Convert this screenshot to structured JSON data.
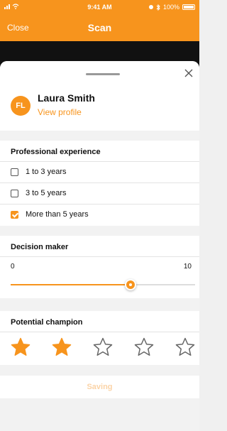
{
  "status_bar": {
    "time": "9:41 AM",
    "battery": "100%"
  },
  "nav": {
    "close_label": "Close",
    "title": "Scan"
  },
  "profile": {
    "initials": "FL",
    "name": "Laura Smith",
    "view_profile_label": "View profile"
  },
  "experience": {
    "title": "Professional experience",
    "options": [
      {
        "label": "1 to 3 years",
        "checked": false
      },
      {
        "label": "3 to 5 years",
        "checked": false
      },
      {
        "label": "More than 5 years",
        "checked": true
      }
    ]
  },
  "decision_maker": {
    "title": "Decision maker",
    "min_label": "0",
    "max_label": "10",
    "value": 6.5,
    "min": 0,
    "max": 10
  },
  "champion": {
    "title": "Potential champion",
    "rating": 2,
    "max_rating": 5
  },
  "save": {
    "label": "Saving"
  },
  "colors": {
    "accent": "#f7941d",
    "accent_faded": "#fbd3a6",
    "background": "#f2f2f2"
  },
  "icons": [
    "wifi-icon",
    "signal-icon",
    "bluetooth-icon",
    "battery-icon",
    "close-icon",
    "star-icon"
  ]
}
